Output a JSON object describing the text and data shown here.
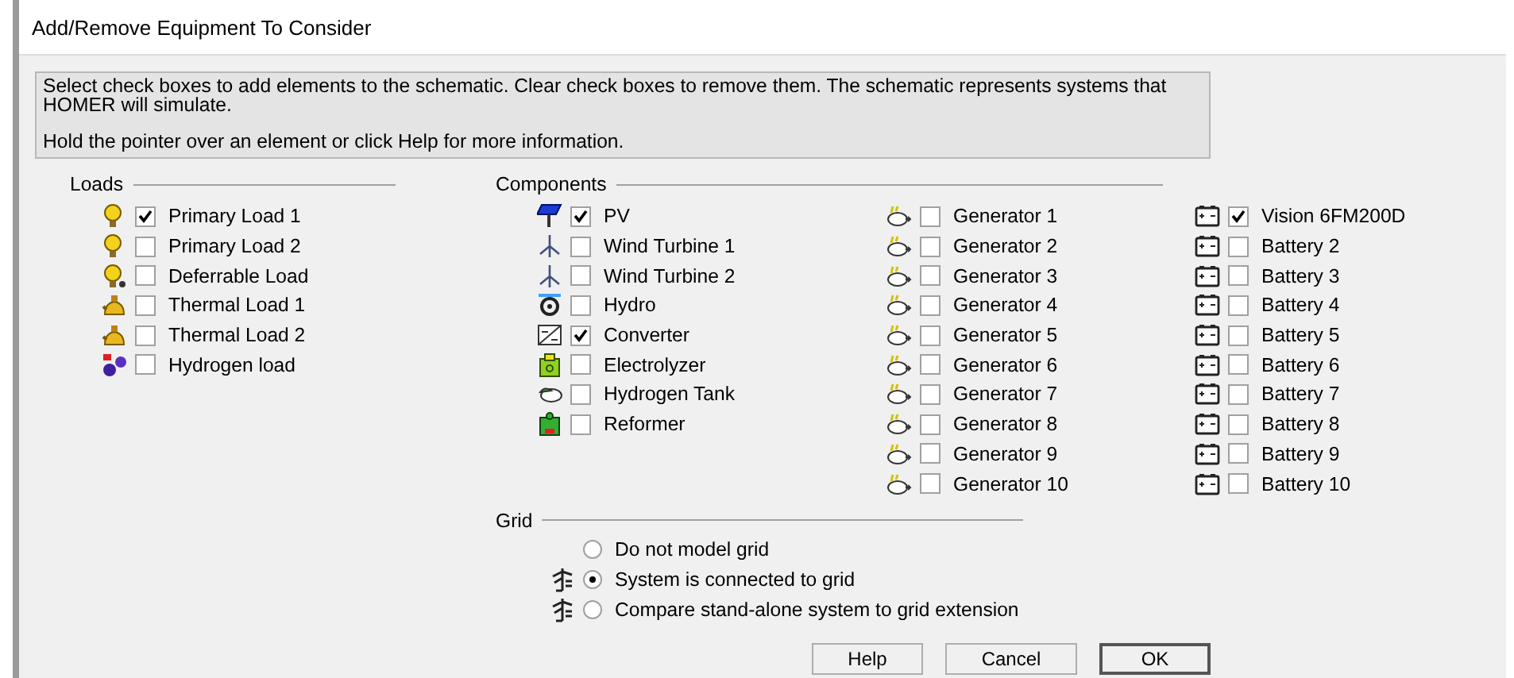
{
  "window": {
    "title": "Add/Remove Equipment To Consider"
  },
  "info": {
    "paragraphs": [
      "Select check boxes to add elements to the schematic. Clear check boxes to remove them. The schematic represents systems that HOMER will simulate.",
      "Hold the pointer over an element or click Help for more information."
    ]
  },
  "loads": {
    "title": "Loads",
    "items": [
      {
        "label": "Primary Load 1",
        "kind": "bulb",
        "checked": true
      },
      {
        "label": "Primary Load 2",
        "kind": "bulb",
        "checked": false
      },
      {
        "label": "Deferrable Load",
        "kind": "deferrable",
        "checked": false
      },
      {
        "label": "Thermal Load 1",
        "kind": "kettle",
        "checked": false
      },
      {
        "label": "Thermal Load 2",
        "kind": "kettle",
        "checked": false
      },
      {
        "label": "Hydrogen load",
        "kind": "hydrogen",
        "checked": false
      }
    ]
  },
  "components": {
    "title": "Components",
    "columns": [
      [
        {
          "label": "PV",
          "kind": "pv",
          "checked": true
        },
        {
          "label": "Wind Turbine 1",
          "kind": "wind",
          "checked": false
        },
        {
          "label": "Wind Turbine 2",
          "kind": "wind",
          "checked": false
        },
        {
          "label": "Hydro",
          "kind": "hydro",
          "checked": false
        },
        {
          "label": "Converter",
          "kind": "converter",
          "checked": true
        },
        {
          "label": "Electrolyzer",
          "kind": "electrolyzer",
          "checked": false
        },
        {
          "label": "Hydrogen Tank",
          "kind": "tank",
          "checked": false
        },
        {
          "label": "Reformer",
          "kind": "reformer",
          "checked": false
        }
      ],
      [
        {
          "label": "Generator 1",
          "kind": "generator",
          "checked": false
        },
        {
          "label": "Generator 2",
          "kind": "generator",
          "checked": false
        },
        {
          "label": "Generator 3",
          "kind": "generator",
          "checked": false
        },
        {
          "label": "Generator 4",
          "kind": "generator",
          "checked": false
        },
        {
          "label": "Generator 5",
          "kind": "generator",
          "checked": false
        },
        {
          "label": "Generator 6",
          "kind": "generator",
          "checked": false
        },
        {
          "label": "Generator 7",
          "kind": "generator",
          "checked": false
        },
        {
          "label": "Generator 8",
          "kind": "generator",
          "checked": false
        },
        {
          "label": "Generator 9",
          "kind": "generator",
          "checked": false
        },
        {
          "label": "Generator 10",
          "kind": "generator",
          "checked": false
        }
      ],
      [
        {
          "label": "Vision 6FM200D",
          "kind": "battery",
          "checked": true
        },
        {
          "label": "Battery 2",
          "kind": "battery",
          "checked": false
        },
        {
          "label": "Battery 3",
          "kind": "battery",
          "checked": false
        },
        {
          "label": "Battery 4",
          "kind": "battery",
          "checked": false
        },
        {
          "label": "Battery 5",
          "kind": "battery",
          "checked": false
        },
        {
          "label": "Battery 6",
          "kind": "battery",
          "checked": false
        },
        {
          "label": "Battery 7",
          "kind": "battery",
          "checked": false
        },
        {
          "label": "Battery 8",
          "kind": "battery",
          "checked": false
        },
        {
          "label": "Battery 9",
          "kind": "battery",
          "checked": false
        },
        {
          "label": "Battery 10",
          "kind": "battery",
          "checked": false
        }
      ]
    ]
  },
  "grid": {
    "title": "Grid",
    "options": [
      {
        "label": "Do not model grid",
        "kind": "plain",
        "selected": false
      },
      {
        "label": "System is connected to grid",
        "kind": "tower",
        "selected": true
      },
      {
        "label": "Compare stand-alone system to grid extension",
        "kind": "tower",
        "selected": false
      }
    ]
  },
  "buttons": [
    {
      "label": "Help",
      "default": false
    },
    {
      "label": "Cancel",
      "default": false
    },
    {
      "label": "OK",
      "default": true
    }
  ]
}
